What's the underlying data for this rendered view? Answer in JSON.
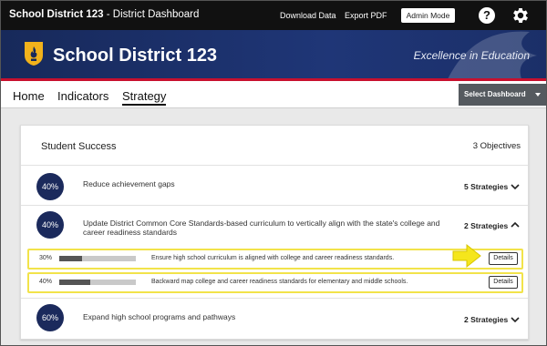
{
  "topbar": {
    "app_title_bold": "School District 123",
    "app_title_rest": " - District Dashboard",
    "download_label": "Download Data",
    "export_label": "Export PDF",
    "admin_label": "Admin Mode",
    "help_glyph": "?"
  },
  "banner": {
    "district_name": "School District 123",
    "tagline": "Excellence in Education",
    "accent_color": "#c8102e",
    "bg_color": "#1f3677"
  },
  "nav": {
    "tabs": [
      {
        "label": "Home"
      },
      {
        "label": "Indicators"
      },
      {
        "label": "Strategy"
      }
    ],
    "select_dashboard": "Select Dashboard"
  },
  "card": {
    "title": "Student Success",
    "count_label": "3 Objectives",
    "objectives": [
      {
        "percent_label": "40%",
        "text": "Reduce achievement gaps",
        "strategies_label": "5 Strategies",
        "expanded": false
      },
      {
        "percent_label": "40%",
        "text_line1": "Update District Common Core Standards-based curriculum to vertically align with the state's college and",
        "text_line2": "career readiness standards",
        "strategies_label": "2 Strategies",
        "expanded": true,
        "strategies": [
          {
            "percent_label": "30%",
            "progress": 0.3,
            "text": "Ensure high school curriculum is aligned with college and career readiness standards.",
            "details_label": "Details"
          },
          {
            "percent_label": "40%",
            "progress": 0.4,
            "text": "Backward map college and career readiness standards for elementary and middle schools.",
            "details_label": "Details"
          }
        ]
      },
      {
        "percent_label": "60%",
        "text": "Expand high school programs and pathways",
        "strategies_label": "2 Strategies",
        "expanded": false
      }
    ]
  },
  "colors": {
    "circle": "#1b2a5c",
    "highlight": "#f2e34a",
    "arrow": "#f5e61c"
  }
}
